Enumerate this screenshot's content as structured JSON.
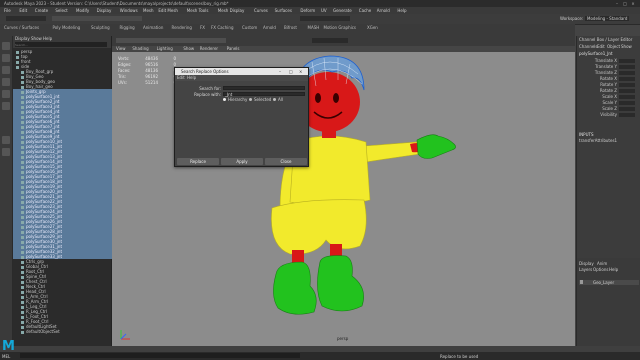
{
  "app": {
    "title": "Autodesk Maya 2023 - Student Version: C:\\Users\\Student\\Documents\\maya\\projects\\default\\scenes\\boy_rig.mb*",
    "logo_letter": "M"
  },
  "menubar": [
    "File",
    "Edit",
    "Create",
    "Select",
    "Modify",
    "Display",
    "Windows",
    "Mesh",
    "Edit Mesh",
    "Mesh Tools",
    "Mesh Display",
    "Curves",
    "Surfaces",
    "Deform",
    "UV",
    "Generate",
    "Cache",
    "Arnold",
    "Help"
  ],
  "workspace": {
    "label": "Workspace:",
    "value": "Modeling - Standard"
  },
  "shelf_tabs": [
    "Curves / Surfaces",
    "Poly Modeling",
    "Sculpting",
    "Rigging",
    "Animation",
    "Rendering",
    "FX",
    "FX Caching",
    "Custom",
    "Arnold",
    "Bifrost",
    "MASH",
    "Motion Graphics",
    "XGen"
  ],
  "outliner": {
    "menu": [
      "Display",
      "Show",
      "Help"
    ],
    "search_placeholder": "Search...",
    "rows": [
      {
        "label": "persp",
        "sel": false
      },
      {
        "label": "top",
        "sel": false
      },
      {
        "label": "front",
        "sel": false
      },
      {
        "label": "side",
        "sel": false
      },
      {
        "label": "Boy_Root_grp",
        "sel": false
      },
      {
        "label": "Boy_Geo",
        "sel": false
      },
      {
        "label": "Boy_body_geo",
        "sel": false
      },
      {
        "label": "Boy_hair_geo",
        "sel": false
      },
      {
        "label": "Joints_grp",
        "sel": true
      },
      {
        "label": "polySurface1_jnt",
        "sel": true
      },
      {
        "label": "polySurface2_jnt",
        "sel": true
      },
      {
        "label": "polySurface3_jnt",
        "sel": true
      },
      {
        "label": "polySurface4_jnt",
        "sel": true
      },
      {
        "label": "polySurface5_jnt",
        "sel": true
      },
      {
        "label": "polySurface6_jnt",
        "sel": true
      },
      {
        "label": "polySurface7_jnt",
        "sel": true
      },
      {
        "label": "polySurface8_jnt",
        "sel": true
      },
      {
        "label": "polySurface9_jnt",
        "sel": true
      },
      {
        "label": "polySurface10_jnt",
        "sel": true
      },
      {
        "label": "polySurface11_jnt",
        "sel": true
      },
      {
        "label": "polySurface12_jnt",
        "sel": true
      },
      {
        "label": "polySurface13_jnt",
        "sel": true
      },
      {
        "label": "polySurface14_jnt",
        "sel": true
      },
      {
        "label": "polySurface15_jnt",
        "sel": true
      },
      {
        "label": "polySurface16_jnt",
        "sel": true
      },
      {
        "label": "polySurface17_jnt",
        "sel": true
      },
      {
        "label": "polySurface18_jnt",
        "sel": true
      },
      {
        "label": "polySurface19_jnt",
        "sel": true
      },
      {
        "label": "polySurface20_jnt",
        "sel": true
      },
      {
        "label": "polySurface21_jnt",
        "sel": true
      },
      {
        "label": "polySurface22_jnt",
        "sel": true
      },
      {
        "label": "polySurface23_jnt",
        "sel": true
      },
      {
        "label": "polySurface24_jnt",
        "sel": true
      },
      {
        "label": "polySurface25_jnt",
        "sel": true
      },
      {
        "label": "polySurface26_jnt",
        "sel": true
      },
      {
        "label": "polySurface27_jnt",
        "sel": true
      },
      {
        "label": "polySurface28_jnt",
        "sel": true
      },
      {
        "label": "polySurface29_jnt",
        "sel": true
      },
      {
        "label": "polySurface30_jnt",
        "sel": true
      },
      {
        "label": "polySurface31_jnt",
        "sel": true
      },
      {
        "label": "polySurface32_jnt",
        "sel": true
      },
      {
        "label": "polySurface33_jnt",
        "sel": true
      },
      {
        "label": "Ctrls_grp",
        "sel": false
      },
      {
        "label": "Global_Ctrl",
        "sel": false
      },
      {
        "label": "Root_Ctrl",
        "sel": false
      },
      {
        "label": "Spine_Ctrl",
        "sel": false
      },
      {
        "label": "Chest_Ctrl",
        "sel": false
      },
      {
        "label": "Neck_Ctrl",
        "sel": false
      },
      {
        "label": "Head_Ctrl",
        "sel": false
      },
      {
        "label": "L_Arm_Ctrl",
        "sel": false
      },
      {
        "label": "R_Arm_Ctrl",
        "sel": false
      },
      {
        "label": "L_Leg_Ctrl",
        "sel": false
      },
      {
        "label": "R_Leg_Ctrl",
        "sel": false
      },
      {
        "label": "L_Foot_Ctrl",
        "sel": false
      },
      {
        "label": "R_Foot_Ctrl",
        "sel": false
      },
      {
        "label": "defaultLightSet",
        "sel": false
      },
      {
        "label": "defaultObjectSet",
        "sel": false
      }
    ]
  },
  "viewport": {
    "menu": [
      "View",
      "Shading",
      "Lighting",
      "Show",
      "Renderer",
      "Panels"
    ],
    "hud": [
      {
        "name": "Verts:",
        "v1": "48436",
        "v2": "0"
      },
      {
        "name": "Edges:",
        "v1": "96516",
        "v2": "0"
      },
      {
        "name": "Faces:",
        "v1": "48136",
        "v2": "0"
      },
      {
        "name": "Tris:",
        "v1": "96192",
        "v2": "0"
      },
      {
        "name": "UVs:",
        "v1": "51214",
        "v2": "0"
      }
    ],
    "camera_label": "persp",
    "colors": {
      "red": "#d81818",
      "yellow": "#f2ea2c",
      "green": "#22c21e",
      "hair": "#5aa8ff",
      "bg": "#8c8c8c"
    }
  },
  "dialog": {
    "title": "Search Replace Options",
    "menu": [
      "Edit",
      "Help"
    ],
    "search_label": "Search for:",
    "search_value": "",
    "replace_label": "Replace with:",
    "replace_value": "_Jnt",
    "radios": [
      "Hierarchy",
      "Selected",
      "All"
    ],
    "buttons": [
      "Replace",
      "Apply",
      "Close"
    ]
  },
  "channel_box": {
    "tabs": [
      "Channel Box / Layer Editor"
    ],
    "menu": [
      "Channels",
      "Edit",
      "Object",
      "Show"
    ],
    "object": "polySurface1_Jnt",
    "attrs": [
      "Translate X",
      "Translate Y",
      "Translate Z",
      "Rotate X",
      "Rotate Y",
      "Rotate Z",
      "Scale X",
      "Scale Y",
      "Scale Z",
      "Visibility"
    ],
    "inputs_label": "INPUTS",
    "inputs_value": "transferAttributes1"
  },
  "layers": {
    "tabs": [
      "Display",
      "Anim"
    ],
    "menu": [
      "Layers",
      "Options",
      "Help"
    ],
    "layer_name": "Geo_Layer"
  },
  "statusbar": {
    "cmd_label": "MEL",
    "message": "Replace to be used"
  }
}
